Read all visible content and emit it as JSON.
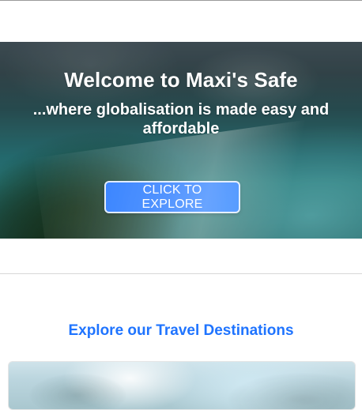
{
  "hero": {
    "title": "Welcome to Maxi's Safe",
    "subtitle_line1": "...where globalisation is made easy and",
    "subtitle_line2": "affordable",
    "cta_label": "CLICK TO EXPLORE"
  },
  "destinations": {
    "title": "Explore our Travel Destinations"
  },
  "colors": {
    "accent_blue": "#1f74ff",
    "hero_overlay": "#000000",
    "divider": "#d7d7d7"
  }
}
